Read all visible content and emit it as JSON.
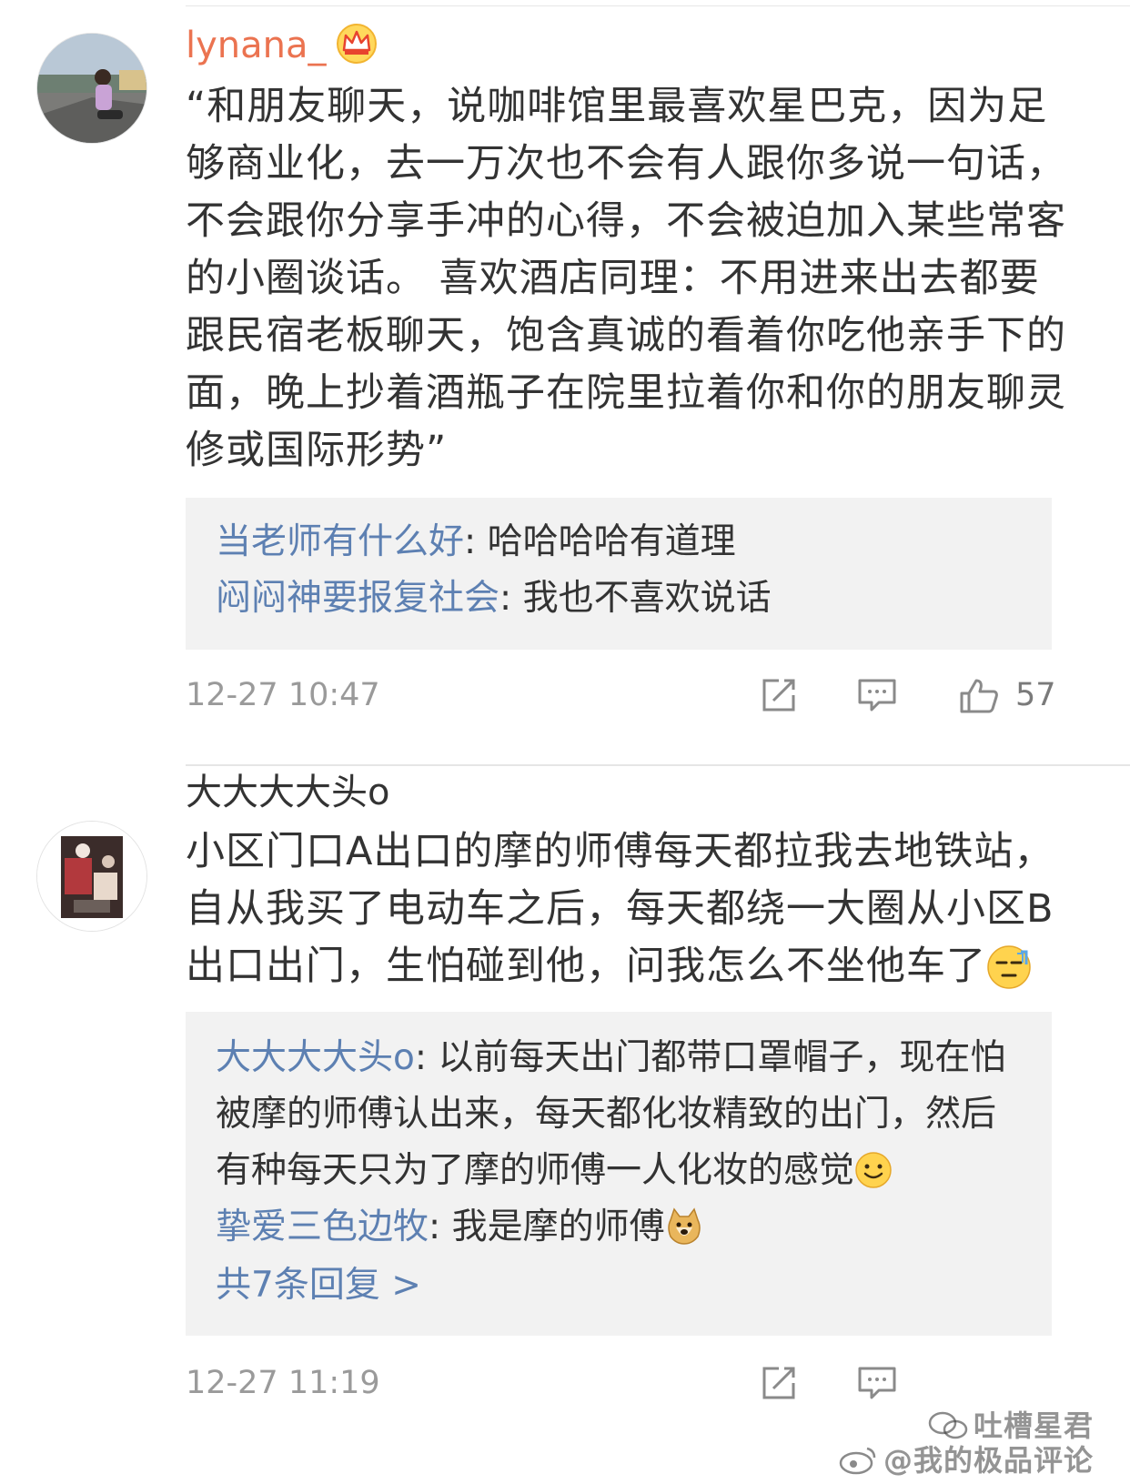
{
  "comments": [
    {
      "username": "lynana_",
      "badge_icon": "crown-icon",
      "text": "“和朋友聊天，说咖啡馆里最喜欢星巴克，因为足够商业化，去一万次也不会有人跟你多说一句话，不会跟你分享手冲的心得，不会被迫加入某些常客的小圈谈话。 喜欢酒店同理：不用进来出去都要跟民宿老板聊天，饱含真诚的看着你吃他亲手下的面，晚上抄着酒瓶子在院里拉着你和你的朋友聊灵修或国际形势”",
      "replies": [
        {
          "name": "当老师有什么好",
          "separator": ": ",
          "text": "哈哈哈哈有道理"
        },
        {
          "name": "闷闷神要报复社会",
          "separator": ": ",
          "text": "我也不喜欢说话"
        }
      ],
      "time": "12-27 10:47",
      "likes": "57"
    },
    {
      "username": "大大大大头o",
      "text": "小区门口A出口的摩的师傅每天都拉我去地铁站，自从我买了电动车之后，每天都绕一大圈从小区B出口出门，生怕碰到他，问我怎么不坐他车了",
      "text_emoji": "sweat-face-emoji",
      "replies": [
        {
          "name": "大大大大头o",
          "separator": ": ",
          "text": "以前每天出门都带口罩帽子，现在怕被摩的师傅认出来，每天都化妆精致的出门，然后有种每天只为了摩的师傅一人化妆的感觉",
          "emoji": "smile-emoji"
        },
        {
          "name": "挚爱三色边牧",
          "separator": ": ",
          "text": "我是摩的师傅",
          "emoji": "doge-emoji"
        }
      ],
      "more_replies": "共7条回复 >",
      "time": "12-27 11:19"
    }
  ],
  "watermark": {
    "line1": "吐槽星君",
    "line2": "@我的极品评论"
  },
  "colors": {
    "accent_name": "#eb7350",
    "link_blue": "#5d80b2",
    "reply_bg": "#f2f2f2",
    "meta_gray": "#9a9a9a"
  }
}
